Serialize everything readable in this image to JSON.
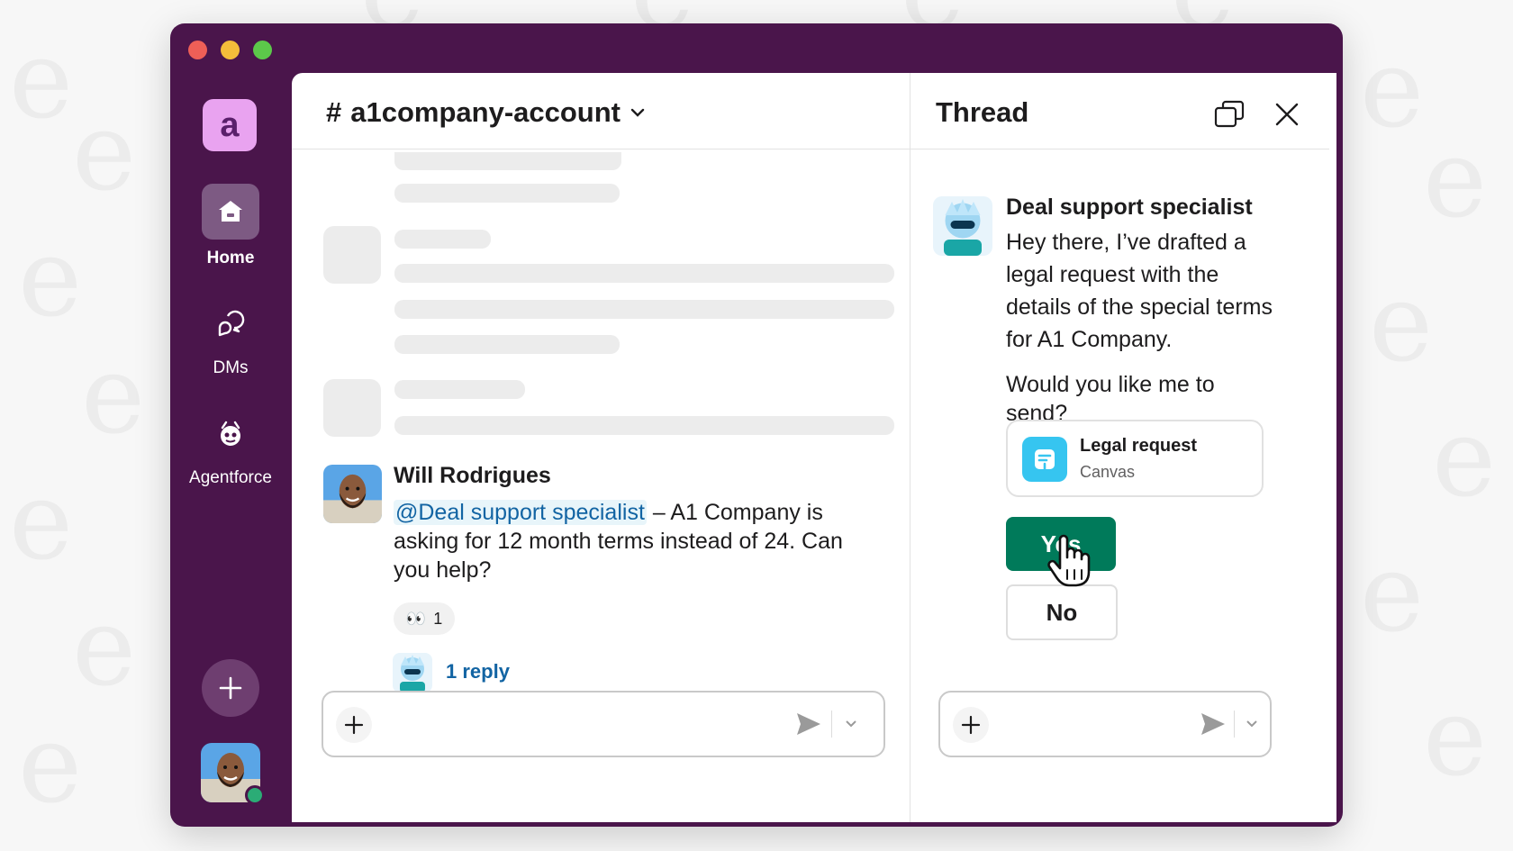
{
  "channel": {
    "hash": "#",
    "name": "a1company-account",
    "message": {
      "author": "Will Rodrigues",
      "mention": "@Deal support specialist",
      "line1_rest": " – A1 Company is",
      "line2": "asking for 12 month terms instead of 24. Can",
      "line3": "you help?",
      "reaction_emoji": "👀",
      "reaction_count": "1",
      "reply_label": "1 reply"
    }
  },
  "sidebar": {
    "workspace_letter": "a",
    "items": [
      {
        "label": "Home"
      },
      {
        "label": "DMs"
      },
      {
        "label": "Agentforce"
      }
    ]
  },
  "thread": {
    "title": "Thread",
    "author": "Deal support specialist",
    "lines": [
      "Hey there, I’ve drafted a",
      "legal request with the",
      "details of the special terms",
      "for A1 Company."
    ],
    "question_lines": [
      "Would you like me to",
      "send?"
    ],
    "canvas_title": "Legal request",
    "canvas_type": "Canvas",
    "yes_label": "Yes",
    "no_label": "No"
  },
  "colors": {
    "aubergine": "#4a154b",
    "yes_green": "#007a5a",
    "link_blue": "#1264a3",
    "canvas_blue": "#36c5f0"
  }
}
